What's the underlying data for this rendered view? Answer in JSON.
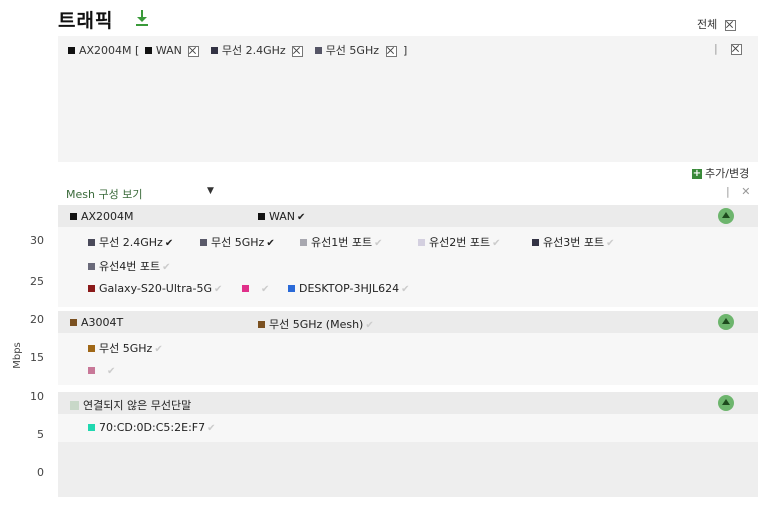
{
  "header": {
    "title": "트래픽",
    "download_icon": "download-icon",
    "all_label": "전체"
  },
  "top_legend": {
    "device": "AX2004M",
    "items": [
      "WAN",
      "무선 2.4GHz",
      "무선 5GHz"
    ],
    "open_bracket": "[",
    "close_bracket": "]",
    "pipe": "|",
    "colors": {
      "device": "#111111",
      "wan": "#111111",
      "w24": "#333344",
      "w5": "#555566"
    }
  },
  "add_change": {
    "label": "추가/변경"
  },
  "mesh": {
    "label": "Mesh 구성 보기",
    "caret": "▼",
    "pipe": "|",
    "close": "✕"
  },
  "y_axis": {
    "label": "Mbps",
    "ticks": [
      "30",
      "25",
      "20",
      "15",
      "10",
      "5",
      "0"
    ]
  },
  "groups": [
    {
      "name": "AX2004M",
      "color": "#111111",
      "uplink": {
        "label": "WAN",
        "color": "#111111",
        "checked": true
      },
      "rows": [
        [
          {
            "label": "무선 2.4GHz",
            "color": "#4a4a5a",
            "checked": true
          },
          {
            "label": "무선 5GHz",
            "color": "#5a5a6a",
            "checked": true
          },
          {
            "label": "유선1번 포트",
            "color": "#a8a8b0",
            "checked": false
          },
          {
            "label": "유선2번 포트",
            "color": "#d4d0e0",
            "checked": false
          },
          {
            "label": "유선3번 포트",
            "color": "#333344",
            "checked": false
          }
        ],
        [
          {
            "label": "유선4번 포트",
            "color": "#6a6a7a",
            "checked": false
          }
        ],
        [
          {
            "label": "Galaxy-S20-Ultra-5G",
            "color": "#8b1a1a",
            "checked": false
          },
          {
            "label": "",
            "color": "#e0308a",
            "checked": false
          },
          {
            "label": "DESKTOP-3HJL624",
            "color": "#2a6ad8",
            "checked": false
          }
        ]
      ]
    },
    {
      "name": "A3004T",
      "color": "#7a5020",
      "uplink": {
        "label": "무선 5GHz (Mesh)",
        "color": "#7a5020",
        "checked": false
      },
      "rows": [
        [
          {
            "label": "무선 5GHz",
            "color": "#a06818",
            "checked": false
          }
        ],
        [
          {
            "label": "",
            "color": "#c87898",
            "checked": false
          }
        ]
      ]
    },
    {
      "name": "연결되지 않은 무선단말",
      "color": "#c8d8c8",
      "rows": [
        [
          {
            "label": "70:CD:0D:C5:2E:F7",
            "color": "#20d8b0",
            "checked": false
          }
        ]
      ]
    }
  ]
}
